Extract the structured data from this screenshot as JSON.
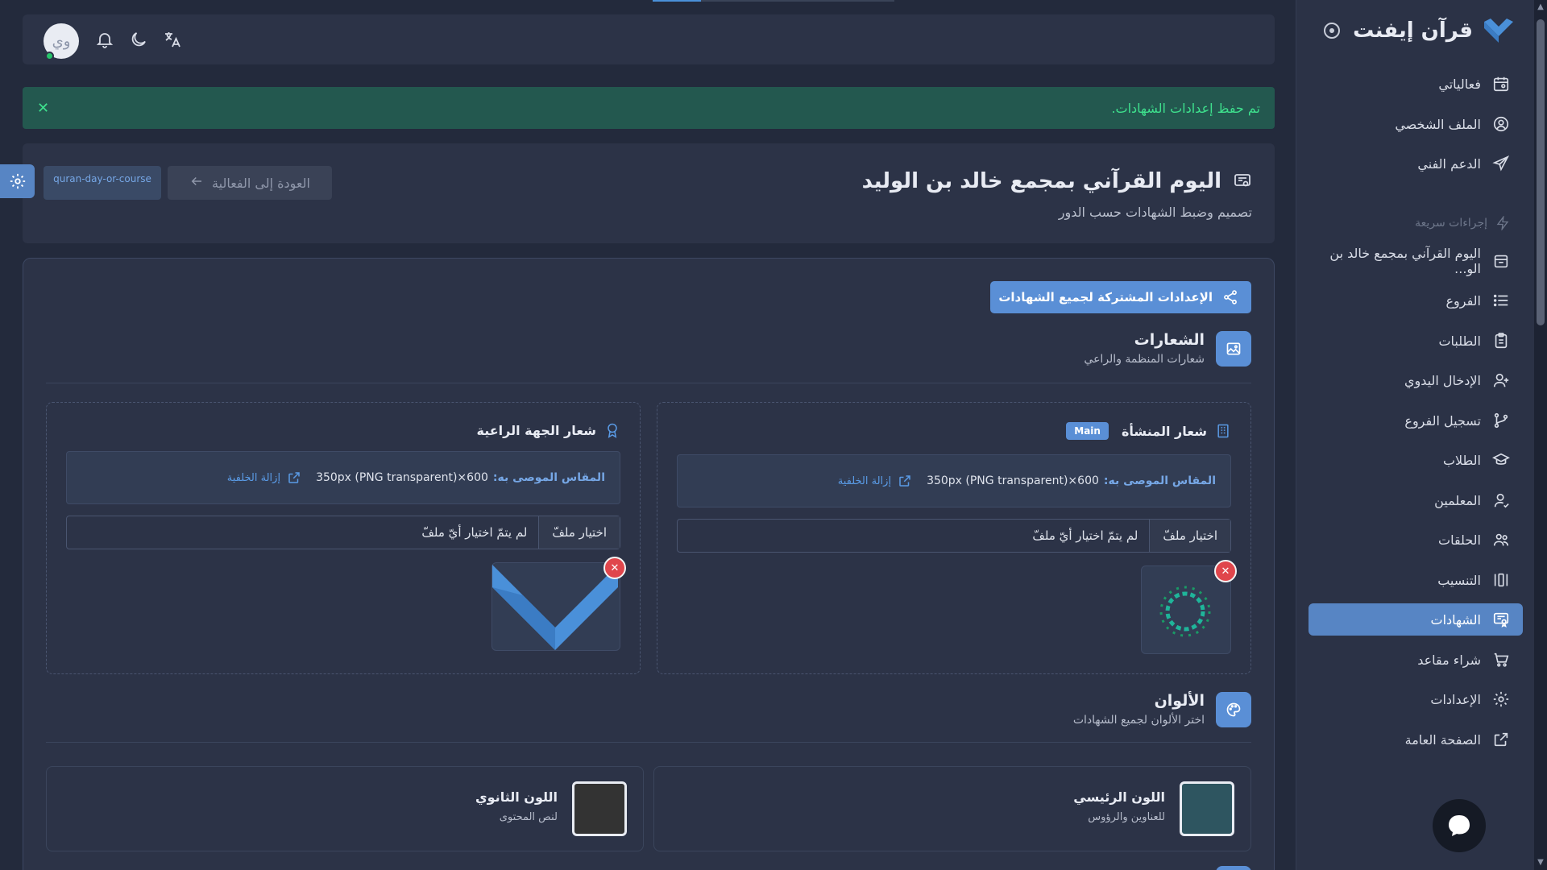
{
  "brand": {
    "name": "قرآن إيفنت",
    "color": "#4a90d9"
  },
  "sidebar": {
    "items": [
      {
        "label": "فعالياتي",
        "icon": "calendar-icon"
      },
      {
        "label": "الملف الشخصي",
        "icon": "user-circle-icon"
      },
      {
        "label": "الدعم الفني",
        "icon": "send-icon"
      }
    ],
    "quick_actions_label": "إجراءات سريعة",
    "event_items": [
      {
        "label": "اليوم القرآني بمجمع خالد بن الو...",
        "icon": "event-icon"
      },
      {
        "label": "الفروع",
        "icon": "list-icon"
      },
      {
        "label": "الطلبات",
        "icon": "clipboard-icon"
      },
      {
        "label": "الإدخال اليدوي",
        "icon": "user-plus-icon"
      },
      {
        "label": "تسجيل الفروع",
        "icon": "git-branch-icon"
      },
      {
        "label": "الطلاب",
        "icon": "graduation-cap-icon"
      },
      {
        "label": "المعلمين",
        "icon": "teacher-icon"
      },
      {
        "label": "الحلقات",
        "icon": "users-icon"
      },
      {
        "label": "التنسيب",
        "icon": "columns-icon"
      },
      {
        "label": "الشهادات",
        "icon": "certificate-icon",
        "active": true
      },
      {
        "label": "شراء مقاعد",
        "icon": "cart-icon"
      },
      {
        "label": "الإعدادات",
        "icon": "gear-icon"
      },
      {
        "label": "الصفحة العامة",
        "icon": "external-link-icon"
      }
    ]
  },
  "topbar": {
    "avatar_initials": "وي",
    "status_color": "#27c46b"
  },
  "alert": {
    "message": "تم حفظ إعدادات الشهادات."
  },
  "header": {
    "title": "اليوم القرآني بمجمع خالد بن الوليد",
    "subtitle": "تصميم وضبط الشهادات حسب الدور",
    "back_label": "العودة إلى الفعالية",
    "slug": "quran-day-or-course"
  },
  "settings": {
    "shared_button_label": "الإعدادات المشتركة لجميع الشهادات",
    "logos_section": {
      "title": "الشعارات",
      "subtitle": "شعارات المنظمة والراعي"
    },
    "org_logo": {
      "title": "شعار المنشأة",
      "badge": "Main",
      "hint_label": "المقاس الموصى به:",
      "hint_value": "350px (PNG transparent)×600",
      "remove_bg_label": "إزالة الخلفية",
      "file_button": "اختيار ملفّ",
      "file_status": "لم يتمّ اختيار أيّ ملفّ"
    },
    "sponsor_logo": {
      "title": "شعار الجهة الراعية",
      "hint_label": "المقاس الموصى به:",
      "hint_value": "350px (PNG transparent)×600",
      "remove_bg_label": "إزالة الخلفية",
      "file_button": "اختيار ملفّ",
      "file_status": "لم يتمّ اختيار أيّ ملفّ"
    },
    "colors_section": {
      "title": "الألوان",
      "subtitle": "اختر الألوان لجميع الشهادات"
    },
    "primary_color": {
      "title": "اللون الرئيسي",
      "desc": "للعناوين والرؤوس",
      "value": "#2e5560"
    },
    "secondary_color": {
      "title": "اللون الثانوي",
      "desc": "لنص المحتوى",
      "value": "#333333"
    }
  }
}
